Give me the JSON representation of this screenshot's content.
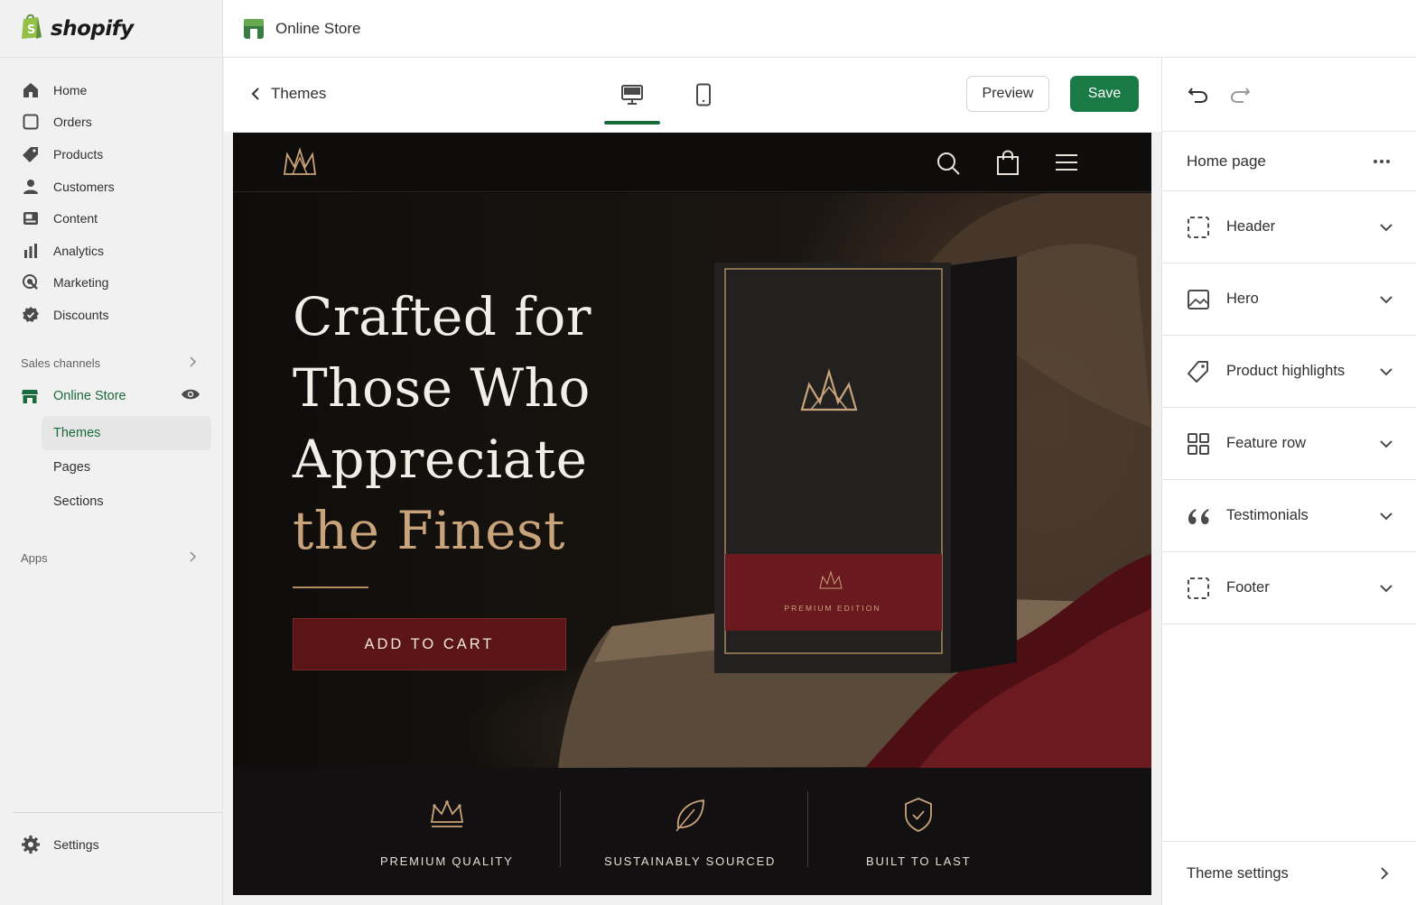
{
  "app": {
    "brand": "shopify",
    "brand_color": "#1a7a46"
  },
  "topbar": {
    "title": "Online Store"
  },
  "sidebar": {
    "items": [
      {
        "label": "Home",
        "icon": "home-icon"
      },
      {
        "label": "Orders",
        "icon": "orders-icon"
      },
      {
        "label": "Products",
        "icon": "tag-icon"
      },
      {
        "label": "Customers",
        "icon": "person-icon"
      },
      {
        "label": "Content",
        "icon": "content-icon"
      },
      {
        "label": "Analytics",
        "icon": "bar-chart-icon"
      },
      {
        "label": "Marketing",
        "icon": "target-icon"
      },
      {
        "label": "Discounts",
        "icon": "discount-icon"
      }
    ],
    "sales_channels_label": "Sales channels",
    "online_store_label": "Online Store",
    "sub_items": [
      {
        "label": "Themes",
        "active": true
      },
      {
        "label": "Pages",
        "active": false
      },
      {
        "label": "Sections",
        "active": false
      }
    ],
    "apps_label": "Apps",
    "settings_label": "Settings"
  },
  "toolbar": {
    "back_label": "Themes",
    "device_options": [
      "desktop",
      "mobile"
    ],
    "active_device": "desktop",
    "preview_label": "Preview",
    "save_label": "Save"
  },
  "preview": {
    "hero": {
      "title_lines": [
        "Crafted for",
        "Those Who",
        "Appreciate"
      ],
      "title_highlight": "the Finest",
      "cta_label": "ADD TO CART",
      "product_label": "PREMIUM EDITION"
    },
    "features": [
      {
        "label": "PREMIUM QUALITY",
        "icon": "crown-icon"
      },
      {
        "label": "SUSTAINABLY SOURCED",
        "icon": "leaf-icon"
      },
      {
        "label": "BUILT TO LAST",
        "icon": "shield-check-icon"
      }
    ],
    "colors": {
      "gold": "#c9a37a",
      "burgundy": "#5b1516",
      "background": "#0e0c0b"
    }
  },
  "panel": {
    "page_label": "Home page",
    "sections": [
      {
        "label": "Header",
        "icon": "dashed-square-icon"
      },
      {
        "label": "Hero",
        "icon": "image-icon"
      },
      {
        "label": "Product highlights",
        "icon": "tag-outline-icon"
      },
      {
        "label": "Feature row",
        "icon": "grid-icon"
      },
      {
        "label": "Testimonials",
        "icon": "quote-icon"
      },
      {
        "label": "Footer",
        "icon": "dashed-square-icon"
      }
    ],
    "theme_settings_label": "Theme settings"
  }
}
